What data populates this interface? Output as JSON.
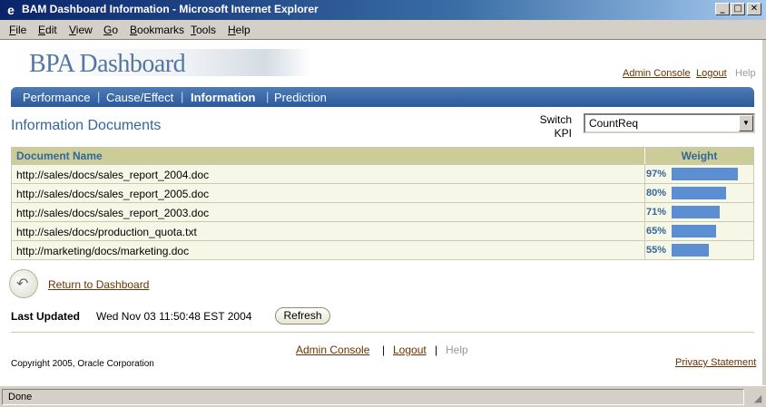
{
  "window": {
    "title": "BAM Dashboard Information - Microsoft Internet Explorer",
    "buttons": {
      "minimize": "_",
      "maximize": "□",
      "close": "✕"
    }
  },
  "menu": [
    "File",
    "Edit",
    "View",
    "Go",
    "Bookmarks",
    "Tools",
    "Help"
  ],
  "logo": "BPA Dashboard",
  "toplinks": {
    "admin": "Admin Console",
    "logout": "Logout",
    "help": "Help"
  },
  "nav": {
    "tabs": [
      "Performance",
      "Cause/Effect",
      "Information",
      "Prediction"
    ],
    "selected": "Information",
    "separator": "|"
  },
  "page_title": "Information Documents",
  "kpi": {
    "label_line1": "Switch",
    "label_line2": "KPI",
    "value": "CountReq"
  },
  "table": {
    "headers": {
      "document": "Document Name",
      "weight": "Weight"
    },
    "rows": [
      {
        "url": "http://sales/docs/sales_report_2004.doc",
        "weight": "97%",
        "fraction": 0.97
      },
      {
        "url": "http://sales/docs/sales_report_2005.doc",
        "weight": "80%",
        "fraction": 0.8
      },
      {
        "url": "http://sales/docs/sales_report_2003.doc",
        "weight": "71%",
        "fraction": 0.71
      },
      {
        "url": "http://sales/docs/production_quota.txt",
        "weight": "65%",
        "fraction": 0.65
      },
      {
        "url": "http://marketing/docs/marketing.doc",
        "weight": "55%",
        "fraction": 0.55
      }
    ]
  },
  "return_link": "Return to Dashboard",
  "last_updated": {
    "label": "Last Updated",
    "value": "Wed Nov 03 11:50:48 EST 2004"
  },
  "refresh_label": "Refresh",
  "footer": {
    "admin": "Admin Console",
    "sep": "|",
    "logout": "Logout",
    "help": "Help"
  },
  "copyright": "Copyright 2005, Oracle Corporation",
  "privacy": "Privacy Statement",
  "status": "Done",
  "colors": {
    "nav": "#2a5a9a",
    "accent": "#336699",
    "bar": "#5b8fd2",
    "table_header": "#cccc99",
    "link": "#663300"
  }
}
